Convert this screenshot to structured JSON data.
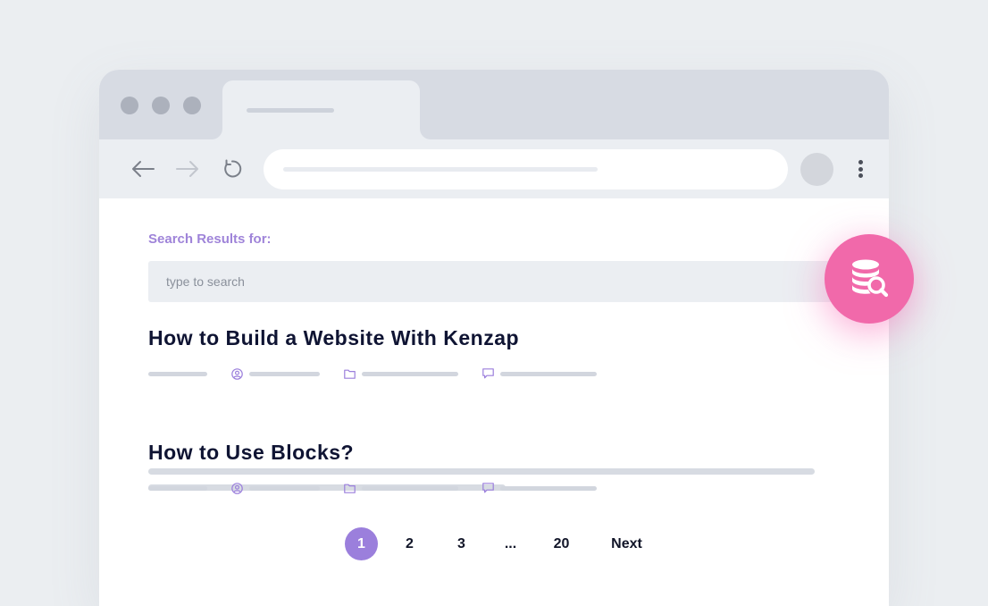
{
  "search": {
    "label": "Search Results for:",
    "placeholder": "type to search"
  },
  "results": [
    {
      "title": "How to Build a Website With Kenzap"
    },
    {
      "title": "How to Use Blocks?"
    }
  ],
  "pagination": {
    "pages": [
      "1",
      "2",
      "3",
      "...",
      "20"
    ],
    "current": "1",
    "next_label": "Next"
  },
  "colors": {
    "accent": "#9b7fdc",
    "fab": "#f169aa",
    "title": "#0f1433"
  },
  "icons": {
    "back": "arrow-left-icon",
    "forward": "arrow-right-icon",
    "reload": "reload-icon",
    "menu": "more-vertical-icon",
    "author": "user-circle-icon",
    "category": "folder-icon",
    "comments": "comment-icon",
    "fab": "database-search-icon"
  }
}
